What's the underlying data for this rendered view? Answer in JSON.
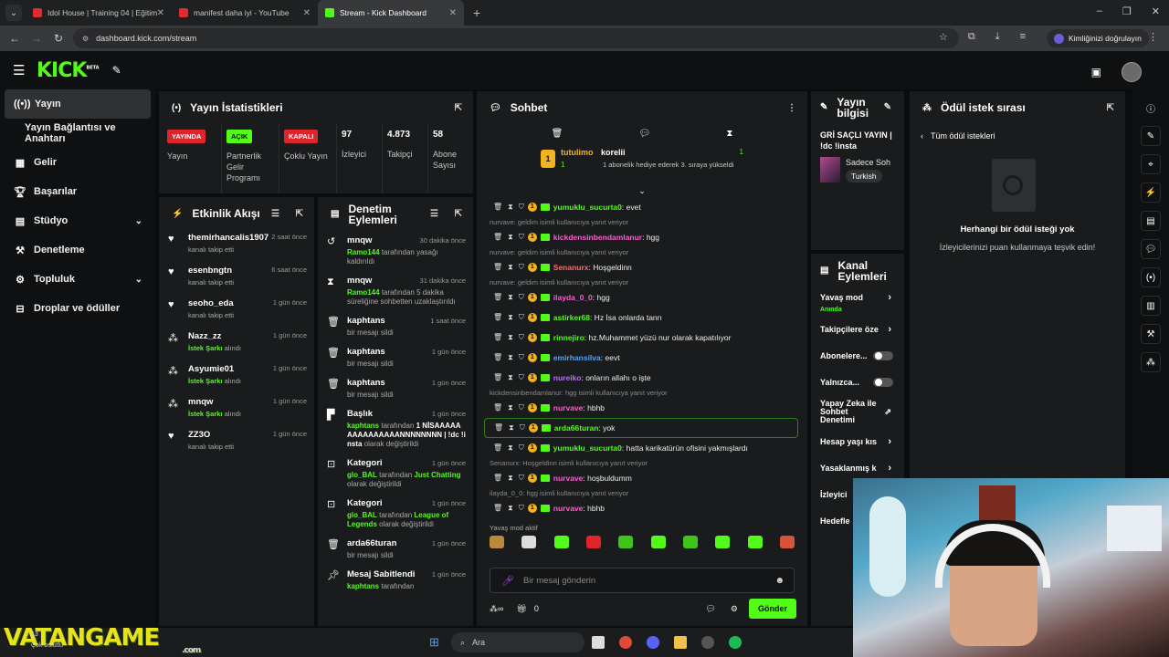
{
  "browser": {
    "tabs": [
      {
        "title": "Idol House | Training 04 | Eğitim",
        "color": "#e22b2b"
      },
      {
        "title": "manifest daha iyi - YouTube",
        "color": "#e22b2b"
      },
      {
        "title": "Stream - Kick Dashboard",
        "color": "#53fc18"
      }
    ],
    "url": "dashboard.kick.com/stream",
    "profile_label": "Kimliğinizi doğrulayın"
  },
  "app": {
    "logo": "KICK",
    "logo_sup": "BETA",
    "accent": "#53fc18"
  },
  "sidebar": {
    "items": [
      {
        "label": "Yayın",
        "icon": "broadcast-icon"
      },
      {
        "label": "Yayın Bağlantısı ve Anahtarı"
      },
      {
        "label": "Gelir",
        "icon": "revenue-icon"
      },
      {
        "label": "Başarılar",
        "icon": "trophy-icon"
      },
      {
        "label": "Stüdyo",
        "icon": "studio-icon"
      },
      {
        "label": "Denetleme",
        "icon": "moderation-icon"
      },
      {
        "label": "Topluluk",
        "icon": "community-icon"
      },
      {
        "label": "Droplar ve ödüller",
        "icon": "drops-icon"
      }
    ]
  },
  "stats": {
    "title": "Yayın İstatistikleri",
    "items": [
      {
        "badge": "YAYINDA",
        "label": "Yayın"
      },
      {
        "badge": "AÇIK",
        "label": "Partnerlik Gelir Programı"
      },
      {
        "badge": "KAPALI",
        "label": "Çoklu Yayın"
      },
      {
        "value": "97",
        "label": "İzleyici"
      },
      {
        "value": "4.873",
        "label": "Takipçi"
      },
      {
        "value": "58",
        "label": "Abone Sayısı"
      }
    ]
  },
  "activity": {
    "title": "Etkinlik Akışı",
    "items": [
      {
        "name": "themirhancalis1907",
        "desc": "kanalı takip etti",
        "time": "2 saat önce"
      },
      {
        "name": "esenbngtn",
        "desc": "kanalı takip etti",
        "time": "6 saat önce"
      },
      {
        "name": "seoho_eda",
        "desc": "kanalı takip etti",
        "time": "1 gün önce"
      },
      {
        "name": "Nazz_zz",
        "desc_hl": "İstek Şarkı",
        "desc": "alındı",
        "time": "1 gün önce"
      },
      {
        "name": "Asyumie01",
        "desc_hl": "İstek Şarkı",
        "desc": "alındı",
        "time": "1 gün önce"
      },
      {
        "name": "mnqw",
        "desc_hl": "İstek Şarkı",
        "desc": "alındı",
        "time": "1 gün önce"
      },
      {
        "name": "ZZ3O",
        "desc": "kanalı takip etti",
        "time": "1 gün önce"
      }
    ]
  },
  "modlog": {
    "title": "Denetim Eylemleri",
    "items": [
      {
        "name": "mnqw",
        "time": "30 dakika önce",
        "actor": "Ramo144",
        "text": "tarafından yasağı kaldırıldı"
      },
      {
        "name": "mnqw",
        "time": "31 dakika önce",
        "actor": "Ramo144",
        "text": "tarafından 5 dakika süreliğine sohbetten uzaklaştırıldı"
      },
      {
        "name": "kaphtans",
        "time": "1 saat önce",
        "text": "bir mesajı sildi"
      },
      {
        "name": "kaphtans",
        "time": "1 gün önce",
        "text": "bir mesajı sildi"
      },
      {
        "name": "kaphtans",
        "time": "1 gün önce",
        "text": "bir mesajı sildi"
      },
      {
        "name": "Başlık",
        "time": "1 gün önce",
        "actor": "kaphtans",
        "text": "tarafından",
        "value": "1 NİSAAAAAAAAAAAAAAANNNNNNNN | !dc !insta",
        "tail": "olarak değiştirildi"
      },
      {
        "name": "Kategori",
        "time": "1 gün önce",
        "actor": "glo_BAL",
        "text": "tarafından",
        "value": "Just Chatting",
        "tail": "olarak değiştirildi"
      },
      {
        "name": "Kategori",
        "time": "1 gün önce",
        "actor": "glo_BAL",
        "text": "tarafından",
        "value": "League of Legends",
        "tail": "olarak değiştirildi"
      },
      {
        "name": "arda66turan",
        "time": "1 gün önce",
        "text": "bir mesajı sildi"
      },
      {
        "name": "Mesaj Sabitlendi",
        "time": "1 gün önce",
        "actor": "kaphtans",
        "text": "tarafından"
      }
    ]
  },
  "chat": {
    "title": "Sohbet",
    "pinned": {
      "user": "tutulimo",
      "count_left": "1",
      "user2": "korelii",
      "desc": "1 abonelik hediye ederek 3. sıraya yükseldi",
      "count_right": "1"
    },
    "messages": [
      {
        "type": "msg",
        "user": "yumuklu_sucurta0",
        "color": "#53fc18",
        "text": ": evet"
      },
      {
        "type": "reply",
        "text": "nurvave: geldim isimli kullanıcıya yanıt veriyor"
      },
      {
        "type": "msg",
        "user": "kickdensinbendamlanur",
        "color": "#ff5ad0",
        "text": ": hgg"
      },
      {
        "type": "reply",
        "text": "nurvave: geldim isimli kullanıcıya yanıt veriyor"
      },
      {
        "type": "msg",
        "user": "Senanurx",
        "color": "#ff6b6b",
        "text": ": Hoşgeldinn"
      },
      {
        "type": "reply",
        "text": "nurvave: geldim isimli kullanıcıya yanıt veriyor"
      },
      {
        "type": "msg",
        "user": "ilayda_0_0",
        "color": "#ff5ad0",
        "text": ": hgg"
      },
      {
        "type": "msg",
        "user": "astirker68",
        "color": "#53fc18",
        "text": ": Hz İsa onlarda tanrı"
      },
      {
        "type": "msg",
        "user": "rinnejiro",
        "color": "#53fc18",
        "text": ": hz.Muhammet yüzü nur olarak kapatılıyor"
      },
      {
        "type": "msg",
        "user": "emirhansilva",
        "color": "#4fa3ff",
        "text": ": eevt"
      },
      {
        "type": "msg",
        "user": "nureiko",
        "color": "#c06bff",
        "text": ": onların allahı o işte"
      },
      {
        "type": "reply",
        "text": "kickdensinbendamlanur: hgg isimli kullanıcıya yanıt veriyor"
      },
      {
        "type": "msg",
        "user": "nurvave",
        "color": "#ff5ad0",
        "text": ": hbhb"
      },
      {
        "type": "msg",
        "user": "arda66turan",
        "color": "#53fc18",
        "text": ": yok",
        "hl": true
      },
      {
        "type": "msg",
        "user": "yumuklu_sucurta0",
        "color": "#53fc18",
        "text": ": hatta karikatürün ofisini yakmışlardı"
      },
      {
        "type": "reply",
        "text": "Senanurx: Hoşgeldinn isimli kullanıcıya yanıt veriyor"
      },
      {
        "type": "msg",
        "user": "nurvave",
        "color": "#ff5ad0",
        "text": ": hoşbuldumm"
      },
      {
        "type": "reply",
        "text": "ilayda_0_0: hgg isimli kullanıcıya yanıt veriyor"
      },
      {
        "type": "msg",
        "user": "nurvave",
        "color": "#ff5ad0",
        "text": ": hbhb"
      }
    ],
    "slow_mode": "Yavaş mod aktif",
    "input_placeholder": "Bir mesaj gönderin",
    "points": "0",
    "send_label": "Gönder"
  },
  "stream_info": {
    "title": "Yayın bilgisi",
    "stream_title": "GRİ SAÇLI YAYIN | !dc !insta",
    "category": "Sadece Soh",
    "language": "Turkish"
  },
  "channel_actions": {
    "title": "Kanal Eylemleri",
    "items": [
      {
        "label": "Yavaş mod",
        "sub": "Anında",
        "kind": "arrow"
      },
      {
        "label": "Takipçilere öze",
        "kind": "arrow"
      },
      {
        "label": "Abonelere...",
        "kind": "toggle"
      },
      {
        "label": "Yalnızca...",
        "kind": "toggle"
      },
      {
        "label": "Yapay Zeka ile Sohbet Denetimi",
        "kind": "ext"
      },
      {
        "label": "Hesap yaşı kıs",
        "kind": "arrow"
      },
      {
        "label": "Yasaklanmış k",
        "kind": "arrow"
      },
      {
        "label": "İzleyici",
        "kind": "none"
      },
      {
        "label": "Hedefle",
        "kind": "none"
      }
    ]
  },
  "rewards": {
    "title": "Ödül istek sırası",
    "back_label": "Tüm ödül istekleri",
    "empty_title": "Herhangi bir ödül isteği yok",
    "empty_desc": "İzleyicilerinizi puan kullanmaya teşvik edin!"
  },
  "taskbar": {
    "search_placeholder": "Ara"
  },
  "watermark": {
    "text": "VATANGAME",
    "sub": ".com",
    "corner": "13",
    "corner2": "Çok bulutlu"
  }
}
